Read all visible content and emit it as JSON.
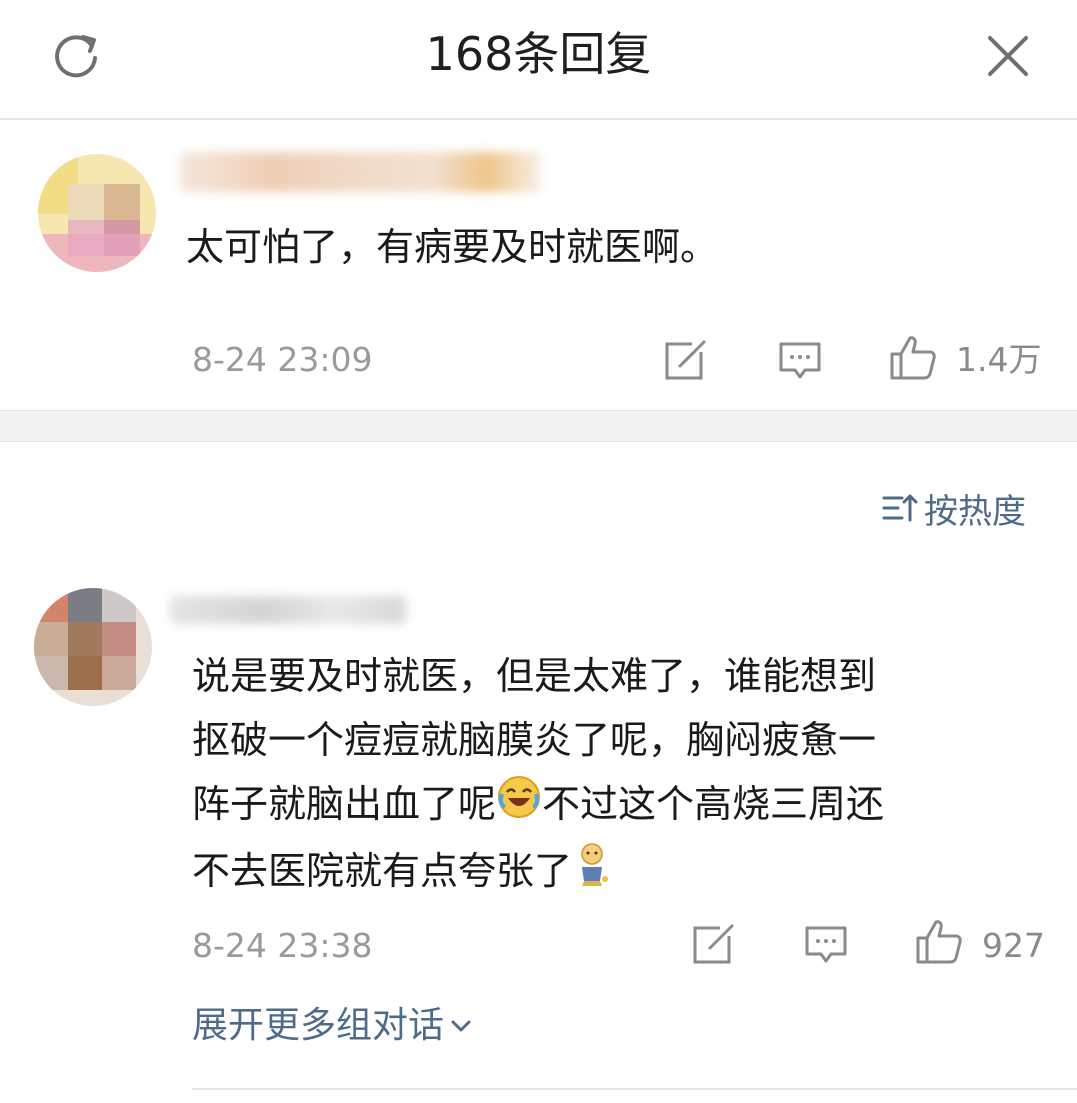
{
  "header": {
    "title": "168条回复",
    "refresh_icon": "refresh-icon",
    "close_icon": "close-icon"
  },
  "root_comment": {
    "text": "太可怕了，有病要及时就医啊。",
    "time": "8-24 23:09",
    "like_count": "1.4万",
    "actions": [
      "repost-icon",
      "comment-icon",
      "thumbs-up-icon"
    ]
  },
  "sort": {
    "label": "按热度",
    "icon": "sort-icon"
  },
  "reply": {
    "lines": [
      "说是要及时就医，但是太难了，谁能想到",
      "抠破一个痘痘就脑膜炎了呢，胸闷疲惫一",
      "阵子就脑出血了呢",
      "不过这个高烧三周还",
      "不去医院就有点夸张了"
    ],
    "time": "8-24 23:38",
    "like_count": "927",
    "actions": [
      "repost-icon",
      "comment-icon",
      "thumbs-up-icon"
    ],
    "expand_label": "展开更多组对话"
  },
  "colors": {
    "link": "#4e6b8a",
    "meta": "#9a9a9a",
    "divider": "#e6e6e6",
    "band": "#f2f2f2"
  }
}
